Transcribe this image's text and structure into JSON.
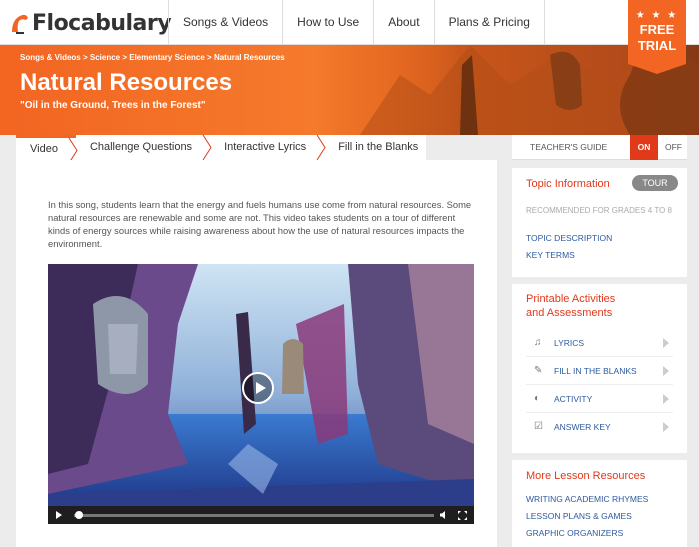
{
  "nav": {
    "logo": "Flocabulary",
    "items": [
      "Songs & Videos",
      "How to Use",
      "About",
      "Plans & Pricing"
    ],
    "free_trial_stars": "★ ★ ★",
    "free_trial_line1": "FREE",
    "free_trial_line2": "TRIAL"
  },
  "hero": {
    "breadcrumb": "Songs & Videos > Science > Elementary Science > Natural Resources",
    "title": "Natural Resources",
    "subtitle": "\"Oil in the Ground, Trees in the Forest\""
  },
  "tabs": [
    {
      "label": "Video",
      "active": true
    },
    {
      "label": "Challenge Questions",
      "active": false
    },
    {
      "label": "Interactive Lyrics",
      "active": false
    },
    {
      "label": "Fill in the Blanks",
      "active": false
    }
  ],
  "main": {
    "description": "In this song, students learn that the energy and fuels humans use come from natural resources. Some natural resources are renewable and some are not. This video takes students on a tour of different kinds of energy sources while raising awareness about how the use of natural resources impacts the environment."
  },
  "teachers_guide": {
    "label": "TEACHER'S GUIDE",
    "on": "ON",
    "off": "OFF"
  },
  "topic_info": {
    "title": "Topic Information",
    "tour": "TOUR",
    "recommended": "RECOMMENDED FOR GRADES 4 TO 8",
    "links": [
      "TOPIC DESCRIPTION",
      "KEY TERMS"
    ]
  },
  "printables": {
    "title_line1": "Printable Activities",
    "title_line2": "and Assessments",
    "items": [
      {
        "label": "LYRICS",
        "icon": "music-note-icon"
      },
      {
        "label": "FILL IN THE BLANKS",
        "icon": "pencil-icon"
      },
      {
        "label": "ACTIVITY",
        "icon": "puzzle-icon"
      },
      {
        "label": "ANSWER KEY",
        "icon": "checkbox-icon"
      }
    ]
  },
  "more": {
    "title": "More Lesson Resources",
    "links": [
      "WRITING ACADEMIC RHYMES",
      "LESSON PLANS & GAMES",
      "GRAPHIC ORGANIZERS"
    ]
  },
  "colors": {
    "accent": "#f26522",
    "red": "#e03a1b",
    "link": "#2d5aa0"
  }
}
